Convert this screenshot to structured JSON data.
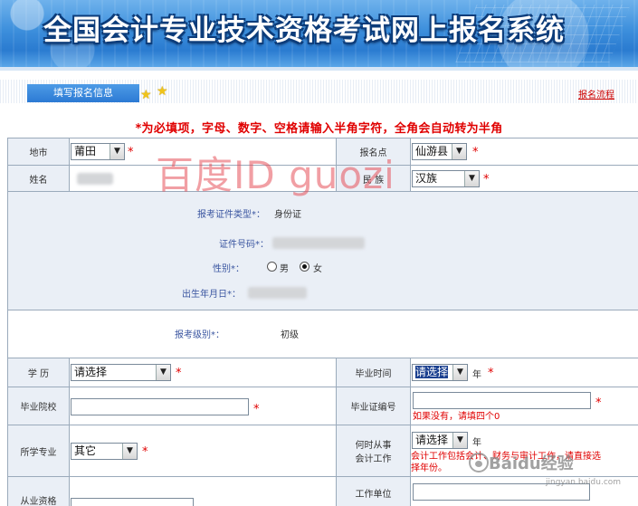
{
  "banner": {
    "title": "全国会计专业技术资格考试网上报名系统"
  },
  "stepbar": {
    "tab_label": "填写报名信息",
    "flow_link": "报名流程"
  },
  "notice": "*为必填项，字母、数字、空格请输入半角字符，全角会自动转为半角",
  "form": {
    "region": {
      "label": "地市",
      "value": "莆田"
    },
    "site": {
      "label": "报名点",
      "value": "仙游县"
    },
    "name": {
      "label": "姓名"
    },
    "ethnicity": {
      "label": "民 族",
      "value": "汉族"
    },
    "id_type": {
      "label": "报考证件类型*：",
      "value": "身份证"
    },
    "id_number": {
      "label": "证件号码*："
    },
    "gender": {
      "label": "性别*：",
      "male": "男",
      "female": "女",
      "selected": "女"
    },
    "birth": {
      "label": "出生年月日*："
    },
    "level": {
      "label": "报考级别*：",
      "value": "初级"
    },
    "education": {
      "label": "学 历",
      "value": "请选择"
    },
    "grad_time": {
      "label": "毕业时间",
      "value": "请选择",
      "unit": "年"
    },
    "school": {
      "label": "毕业院校"
    },
    "cert_no": {
      "label": "毕业证编号",
      "hint": "如果没有，请填四个0"
    },
    "major": {
      "label": "所学专业",
      "value": "其它"
    },
    "work_start": {
      "label_line1": "何时从事",
      "label_line2": "会计工作",
      "value": "请选择",
      "unit": "年",
      "hint_line1": "会计工作包括会计、财务与审计工作，请直接选",
      "hint_line2": "择年份。"
    },
    "qualification": {
      "label": "从业资格"
    },
    "employer": {
      "label": "工作单位"
    }
  },
  "watermarks": {
    "baidu_id": "百度ID guozi",
    "jingyan": "Baidu经验",
    "jingyan_sub": "jingyan.baidu.com"
  },
  "colors": {
    "banner_blue": "#3d8fdc",
    "label_bg": "#eaeff6",
    "required_red": "#e00000",
    "border": "#9aaabb"
  }
}
